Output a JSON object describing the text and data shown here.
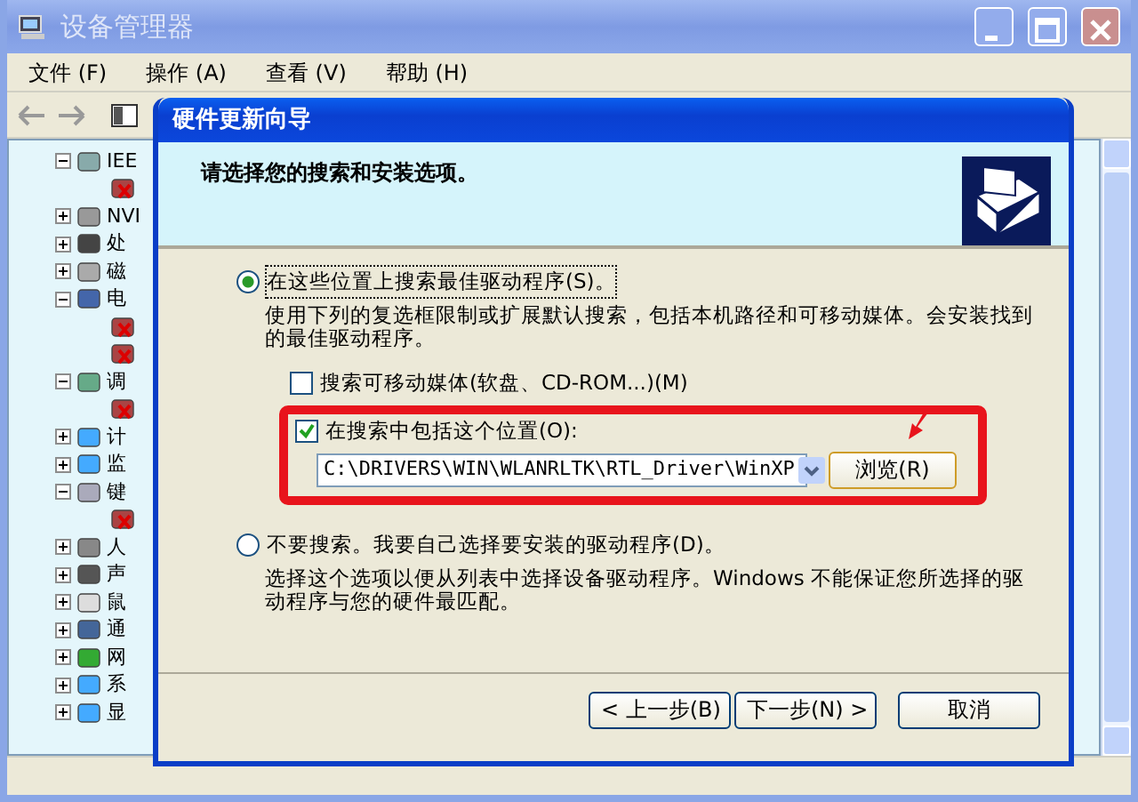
{
  "window": {
    "title": "设备管理器"
  },
  "menu": [
    "文件 (F)",
    "操作 (A)",
    "查看 (V)",
    "帮助 (H)"
  ],
  "tree": [
    {
      "label": "IEE",
      "expanded": true,
      "children": [
        {
          "kind": "device"
        }
      ]
    },
    {
      "label": "NVI",
      "expanded": false
    },
    {
      "label": "处",
      "expanded": false
    },
    {
      "label": "磁",
      "expanded": false
    },
    {
      "label": "电",
      "expanded": true,
      "children": [
        {
          "kind": "device"
        },
        {
          "kind": "device"
        }
      ]
    },
    {
      "label": "调",
      "expanded": true,
      "children": [
        {
          "kind": "device"
        }
      ]
    },
    {
      "label": "计",
      "expanded": false
    },
    {
      "label": "监",
      "expanded": false
    },
    {
      "label": "键",
      "expanded": true,
      "children": [
        {
          "kind": "device"
        }
      ]
    },
    {
      "label": "人",
      "expanded": false
    },
    {
      "label": "声",
      "expanded": false
    },
    {
      "label": "鼠",
      "expanded": false
    },
    {
      "label": "通",
      "expanded": false
    },
    {
      "label": "网",
      "expanded": false
    },
    {
      "label": "系",
      "expanded": false
    },
    {
      "label": "显",
      "expanded": false
    }
  ],
  "dialog": {
    "title": "硬件更新向导",
    "heading": "请选择您的搜索和安装选项。",
    "options": [
      {
        "label": "在这些位置上搜索最佳驱动程序(S)。",
        "selected": true,
        "description": "使用下列的复选框限制或扩展默认搜索，包括本机路径和可移动媒体。会安装找到的最佳驱动程序。",
        "checkboxes": [
          {
            "label": "搜索可移动媒体(软盘、CD-ROM...)(M)",
            "checked": false
          },
          {
            "label": "在搜索中包括这个位置(O):",
            "checked": true
          }
        ],
        "path": "C:\\DRIVERS\\WIN\\WLANRLTK\\RTL_Driver\\WinXP",
        "browse": "浏览(R)"
      },
      {
        "label": "不要搜索。我要自己选择要安装的驱动程序(D)。",
        "selected": false,
        "description": "选择这个选项以便从列表中选择设备驱动程序。Windows 不能保证您所选择的驱动程序与您的硬件最匹配。"
      }
    ],
    "buttons": [
      "< 上一步(B)",
      "下一步(N) >",
      "取消"
    ]
  }
}
